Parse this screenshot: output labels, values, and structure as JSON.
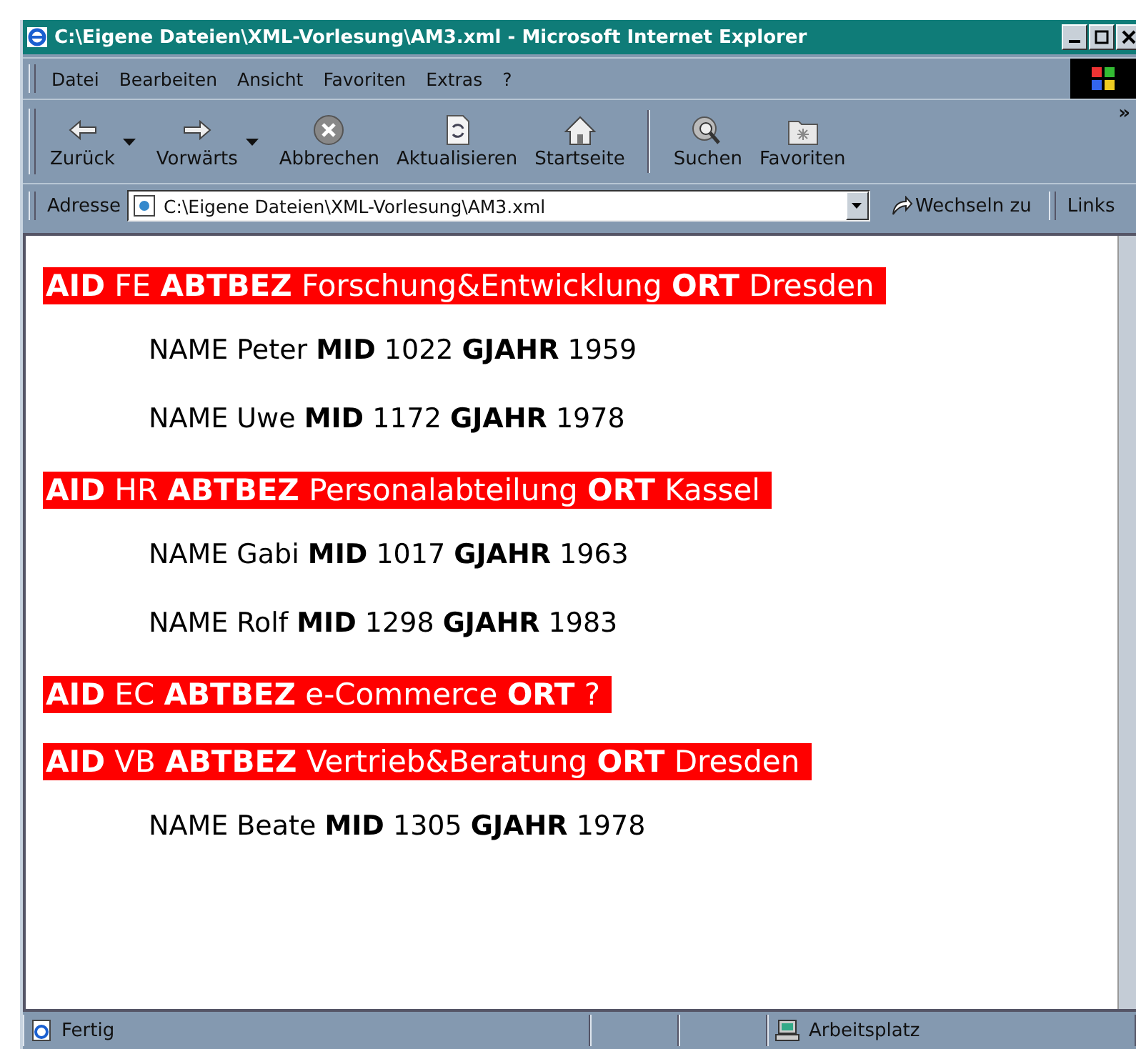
{
  "window": {
    "title": "C:\\Eigene Dateien\\XML-Vorlesung\\AM3.xml - Microsoft Internet Explorer"
  },
  "menu": [
    "Datei",
    "Bearbeiten",
    "Ansicht",
    "Favoriten",
    "Extras",
    "?"
  ],
  "toolbar": [
    {
      "label": "Zurück",
      "kind": "back",
      "dropdown": true
    },
    {
      "label": "Vorwärts",
      "kind": "forward",
      "dropdown": true
    },
    {
      "label": "Abbrechen",
      "kind": "stop",
      "dropdown": false
    },
    {
      "label": "Aktualisieren",
      "kind": "refresh",
      "dropdown": false
    },
    {
      "label": "Startseite",
      "kind": "home",
      "dropdown": false
    },
    {
      "label": "Suchen",
      "kind": "search",
      "dropdown": false
    },
    {
      "label": "Favoriten",
      "kind": "favorites",
      "dropdown": false
    }
  ],
  "toolbar_more": "»",
  "address": {
    "label": "Adresse",
    "value": "C:\\Eigene Dateien\\XML-Vorlesung\\AM3.xml",
    "go": "Wechseln zu",
    "links": "Links"
  },
  "content": [
    {
      "kind": "department",
      "text": "**AID** FE **ABTBEZ** Forschung&Entwicklung **ORT** Dresden"
    },
    {
      "kind": "employee",
      "text": "NAME Peter **MID** 1022 **GJAHR** 1959"
    },
    {
      "kind": "employee",
      "text": "NAME Uwe **MID** 1172 **GJAHR** 1978"
    },
    {
      "kind": "department",
      "text": "**AID** HR **ABTBEZ** Personalabteilung **ORT** Kassel"
    },
    {
      "kind": "employee",
      "text": "NAME Gabi **MID** 1017 **GJAHR** 1963"
    },
    {
      "kind": "employee",
      "text": "NAME Rolf **MID** 1298 **GJAHR** 1983"
    },
    {
      "kind": "department",
      "text": "**AID** EC **ABTBEZ** e-Commerce **ORT** ?"
    },
    {
      "kind": "department",
      "text": "**AID** VB **ABTBEZ** Vertrieb&Beratung **ORT** Dresden"
    },
    {
      "kind": "employee",
      "text": "NAME Beate **MID** 1305 **GJAHR** 1978"
    }
  ],
  "status_bar": {
    "status": "Fertig",
    "zone": "Arbeitsplatz"
  }
}
